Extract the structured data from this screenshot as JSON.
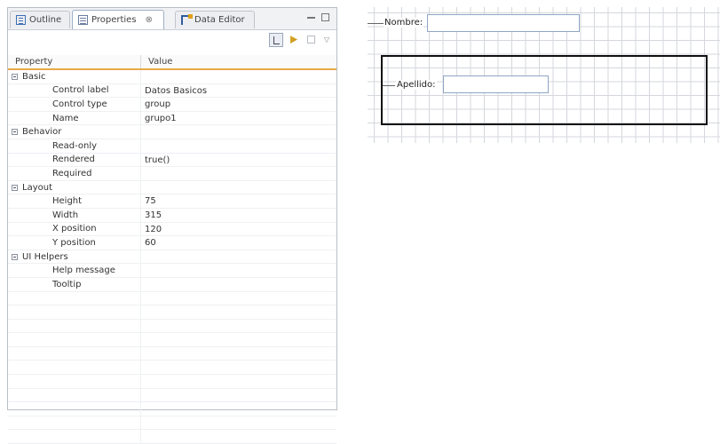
{
  "tabs": [
    {
      "label": "Outline",
      "icon": "outline-icon"
    },
    {
      "label": "Properties",
      "icon": "properties-icon",
      "close": "⊗"
    },
    {
      "label": "Data Editor",
      "icon": "data-editor-icon"
    }
  ],
  "table": {
    "header_property": "Property",
    "header_value": "Value"
  },
  "categories": {
    "basic": "Basic",
    "behavior": "Behavior",
    "layout": "Layout",
    "ui_helpers": "UI Helpers"
  },
  "rows": {
    "control_label": {
      "name": "Control label",
      "value": "Datos Basicos"
    },
    "control_type": {
      "name": "Control type",
      "value": "group"
    },
    "name": {
      "name": "Name",
      "value": "grupo1"
    },
    "read_only": {
      "name": "Read-only",
      "value": ""
    },
    "rendered": {
      "name": "Rendered",
      "value": "true()"
    },
    "required": {
      "name": "Required",
      "value": ""
    },
    "height": {
      "name": "Height",
      "value": "75"
    },
    "width": {
      "name": "Width",
      "value": "315"
    },
    "x_position": {
      "name": "X position",
      "value": "120"
    },
    "y_position": {
      "name": "Y position",
      "value": "60"
    },
    "help_message": {
      "name": "Help message",
      "value": ""
    },
    "tooltip": {
      "name": "Tooltip",
      "value": ""
    }
  },
  "designer": {
    "nombre_label": "Nombre:",
    "apellido_label": "Apellido:",
    "nombre_value": "",
    "apellido_value": ""
  }
}
